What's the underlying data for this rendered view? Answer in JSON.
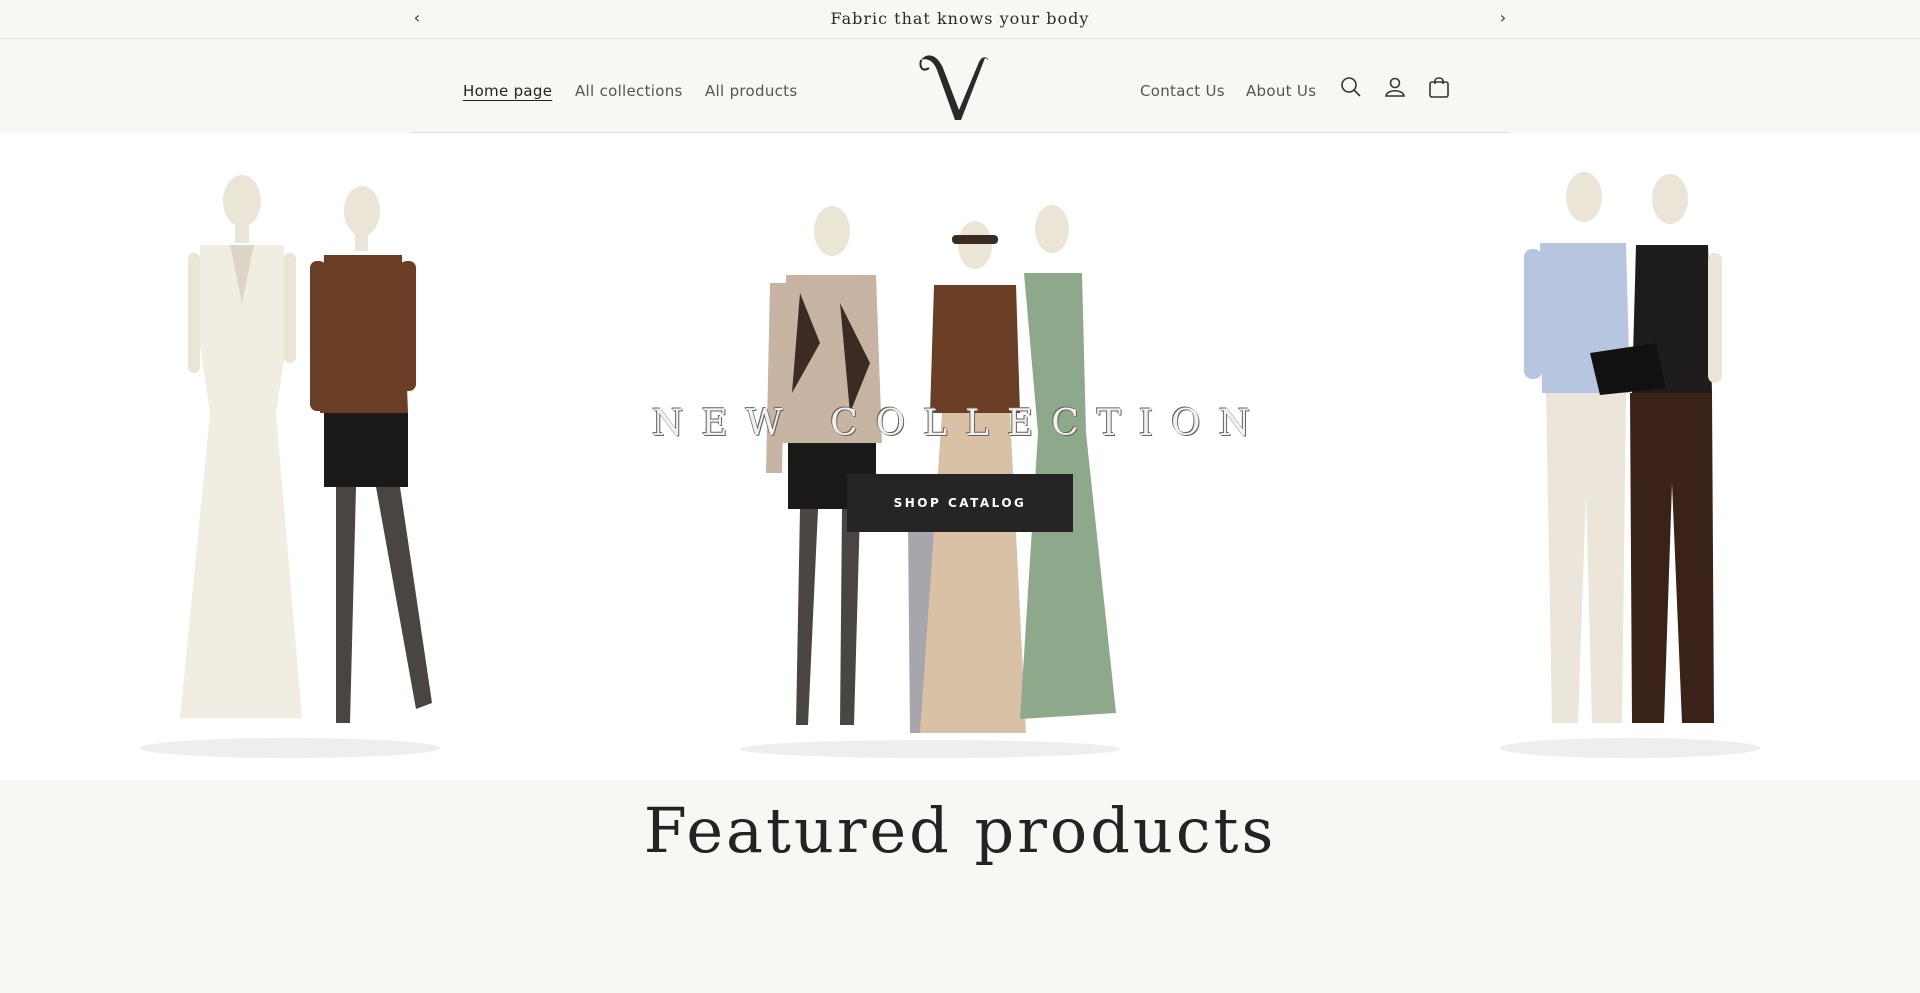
{
  "announcement": {
    "text": "Fabric that knows your body",
    "prev_icon": "chevron-left-icon",
    "next_icon": "chevron-right-icon"
  },
  "header": {
    "nav_left": [
      {
        "label": "Home page",
        "active": true
      },
      {
        "label": "All collections",
        "active": false
      },
      {
        "label": "All products",
        "active": false
      }
    ],
    "logo_letter": "V",
    "nav_right": [
      {
        "label": "Contact Us"
      },
      {
        "label": "About Us"
      }
    ],
    "icons": [
      "search-icon",
      "account-icon",
      "cart-icon"
    ]
  },
  "hero": {
    "title": "NEW COLLECTION",
    "button_label": "SHOP CATALOG"
  },
  "featured": {
    "heading": "Featured products"
  },
  "colors": {
    "background": "#f8f7f3",
    "hero_background": "#ffffff",
    "button": "#262424",
    "text": "#232323"
  }
}
